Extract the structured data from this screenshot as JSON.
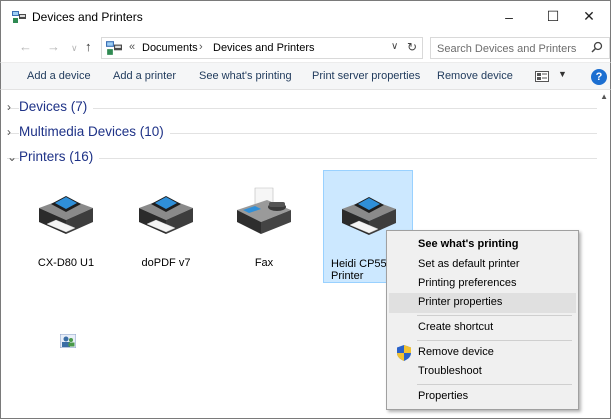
{
  "window": {
    "title": "Devices and Printers",
    "controls": {
      "minimize": "–",
      "maximize": "☐",
      "close": "✕"
    }
  },
  "address": {
    "overflow": "«",
    "crumbs": [
      "Documents",
      "Devices and Printers"
    ],
    "separator": "›"
  },
  "search": {
    "placeholder": "Search Devices and Printers"
  },
  "commands": [
    "Add a device",
    "Add a printer",
    "See what's printing",
    "Print server properties",
    "Remove device"
  ],
  "help_label": "?",
  "groups": [
    {
      "label": "Devices (7)",
      "expanded": false
    },
    {
      "label": "Multimedia Devices (10)",
      "expanded": false
    },
    {
      "label": "Printers (16)",
      "expanded": true
    }
  ],
  "printers": [
    {
      "name": "CX-D80 U1",
      "icon": "printer-icon",
      "selected": false
    },
    {
      "name": "doPDF v7",
      "icon": "printer-icon",
      "selected": false
    },
    {
      "name": "Fax",
      "icon": "fax-icon",
      "selected": false
    },
    {
      "name": "Heidi CP55 C\nPrinter",
      "icon": "printer-icon",
      "selected": true
    }
  ],
  "context_menu": {
    "items": [
      {
        "label": "See what's printing",
        "bold": true
      },
      {
        "label": "Set as default printer"
      },
      {
        "label": "Printing preferences"
      },
      {
        "label": "Printer properties",
        "highlighted": true
      },
      {
        "label": "Create shortcut"
      },
      {
        "label": "Remove device",
        "icon": "shield-icon"
      },
      {
        "label": "Troubleshoot"
      },
      {
        "label": "Properties"
      }
    ]
  },
  "colors": {
    "group_header": "#1e3287",
    "command_text": "#1e395b",
    "selection_bg": "#cce8ff",
    "selection_border": "#99d1ff",
    "menu_bg": "#f0f0f0"
  }
}
